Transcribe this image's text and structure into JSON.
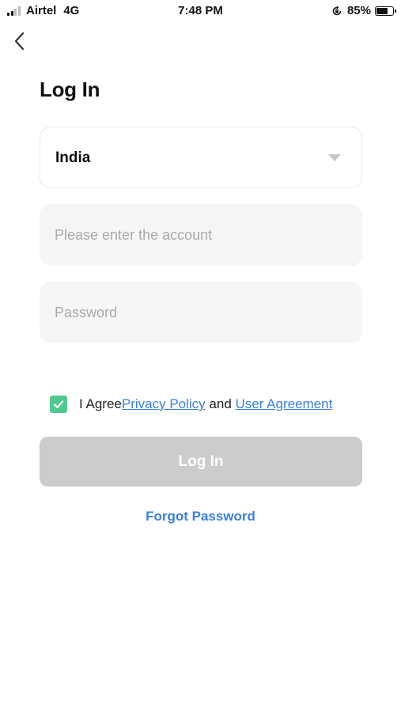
{
  "status_bar": {
    "carrier": "Airtel",
    "network": "4G",
    "time": "7:48 PM",
    "battery_percent": "85%",
    "battery_level": 0.85
  },
  "header": {
    "back_icon": "chevron-left-icon",
    "title": "Log In"
  },
  "form": {
    "country": {
      "value": "India",
      "icon": "chevron-down-icon"
    },
    "account": {
      "placeholder": "Please enter the account",
      "value": ""
    },
    "password": {
      "placeholder": "Password",
      "value": ""
    },
    "agreement": {
      "checked": true,
      "prefix": "I Agree",
      "privacy_link": "Privacy Policy",
      "joiner": " and ",
      "user_agreement_link": "User Agreement"
    },
    "submit_label": "Log In",
    "forgot_label": "Forgot Password"
  },
  "colors": {
    "accent_link": "#3b7fe0",
    "checkbox_green": "#4fc98e",
    "button_disabled": "#cccccc",
    "input_bg": "#f6f6f6"
  }
}
